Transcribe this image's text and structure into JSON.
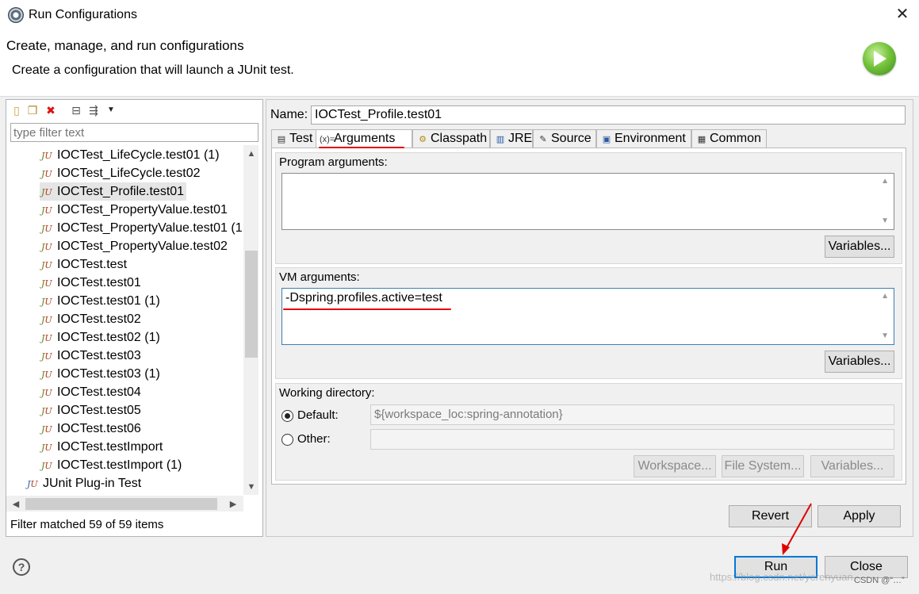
{
  "window": {
    "title": "Run Configurations",
    "close_glyph": "✕",
    "icon": "eclipse-icon"
  },
  "header": {
    "title": "Create, manage, and run configurations",
    "message": "Create a configuration that will launch a JUnit test.",
    "icon": "run-icon"
  },
  "left": {
    "toolbar": [
      "new-config-icon",
      "duplicate-icon",
      "delete-icon",
      "collapse-all-icon",
      "filter-icon",
      "dropdown-icon"
    ],
    "filter_placeholder": "type filter text",
    "tree_items": [
      {
        "label": "IOCTest_LifeCycle.test01 (1)"
      },
      {
        "label": "IOCTest_LifeCycle.test02"
      },
      {
        "label": "IOCTest_Profile.test01",
        "selected": true
      },
      {
        "label": "IOCTest_PropertyValue.test01"
      },
      {
        "label": "IOCTest_PropertyValue.test01 (1"
      },
      {
        "label": "IOCTest_PropertyValue.test02"
      },
      {
        "label": "IOCTest.test"
      },
      {
        "label": "IOCTest.test01"
      },
      {
        "label": "IOCTest.test01 (1)"
      },
      {
        "label": "IOCTest.test02"
      },
      {
        "label": "IOCTest.test02 (1)"
      },
      {
        "label": "IOCTest.test03"
      },
      {
        "label": "IOCTest.test03 (1)"
      },
      {
        "label": "IOCTest.test04"
      },
      {
        "label": "IOCTest.test05"
      },
      {
        "label": "IOCTest.test06"
      },
      {
        "label": "IOCTest.testImport"
      },
      {
        "label": "IOCTest.testImport (1)"
      }
    ],
    "category": "JUnit Plug-in Test",
    "filter_status": "Filter matched 59 of 59 items"
  },
  "config": {
    "name_label": "Name:",
    "name_value": "IOCTest_Profile.test01",
    "tabs": [
      {
        "label": "Test",
        "icon": "test-tab-icon"
      },
      {
        "label": "Arguments",
        "icon": "arguments-tab-icon",
        "active": true
      },
      {
        "label": "Classpath",
        "icon": "classpath-tab-icon"
      },
      {
        "label": "JRE",
        "icon": "jre-tab-icon"
      },
      {
        "label": "Source",
        "icon": "source-tab-icon"
      },
      {
        "label": "Environment",
        "icon": "environment-tab-icon"
      },
      {
        "label": "Common",
        "icon": "common-tab-icon"
      }
    ],
    "program_args_label": "Program arguments:",
    "program_args_value": "",
    "vm_args_label": "VM arguments:",
    "vm_args_value": "-Dspring.profiles.active=test",
    "variables_label": "Variables...",
    "working_dir_label": "Working directory:",
    "default_label": "Default:",
    "default_value": "${workspace_loc:spring-annotation}",
    "other_label": "Other:",
    "other_value": "",
    "workspace_btn": "Workspace...",
    "filesystem_btn": "File System...",
    "variables_btn": "Variables...",
    "revert_label": "Revert",
    "apply_label": "Apply"
  },
  "footer": {
    "help_glyph": "?",
    "run_label": "Run",
    "close_label": "Close",
    "watermark": "https://blog.csdn.net/yerenyuan...",
    "watermark_badge": "CSDN @“…”"
  },
  "colors": {
    "annotation": "#e00000",
    "focus": "#0078d7"
  }
}
